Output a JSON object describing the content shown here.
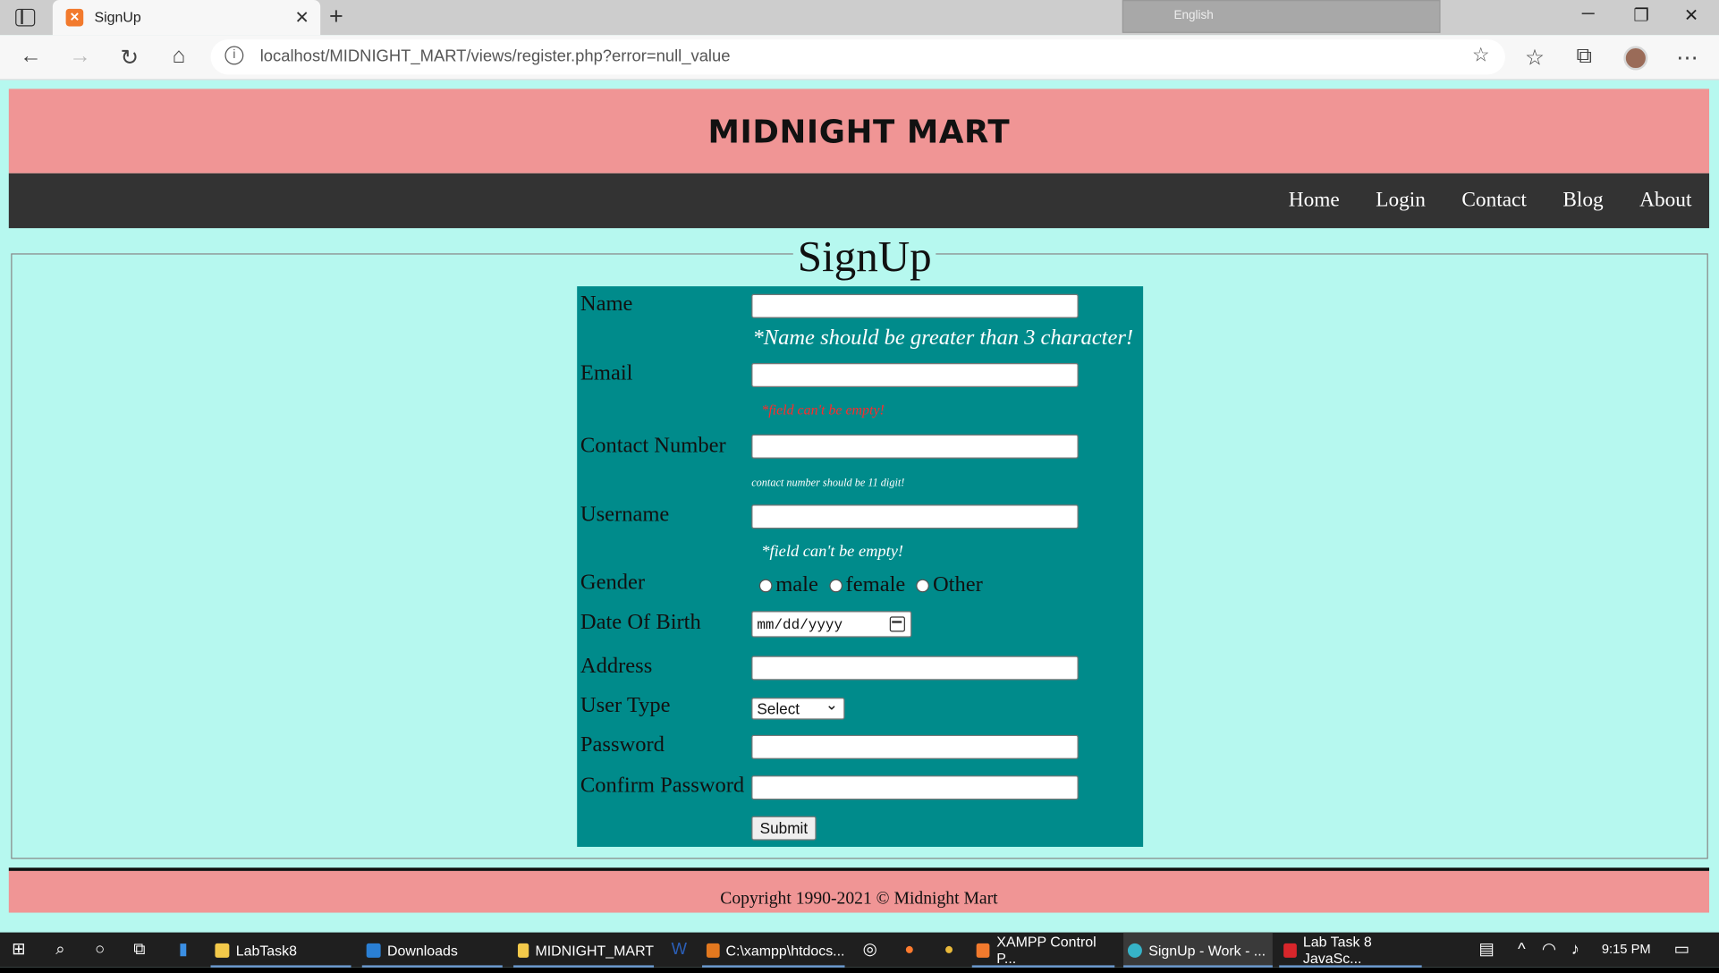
{
  "browser": {
    "tab_title": "SignUp",
    "url": "localhost/MIDNIGHT_MART/views/register.php?error=null_value",
    "lang": "English"
  },
  "site": {
    "title": "MIDNIGHT MART",
    "nav": [
      "Home",
      "Login",
      "Contact",
      "Blog",
      "About"
    ],
    "footer": "Copyright 1990-2021 © Midnight Mart"
  },
  "form": {
    "legend": "SignUp",
    "labels": {
      "name": "Name",
      "email": "Email",
      "contact": "Contact Number",
      "username": "Username",
      "gender": "Gender",
      "dob": "Date Of Birth",
      "address": "Address",
      "user_type": "User Type",
      "password": "Password",
      "confirm_password": "Confirm Password"
    },
    "messages": {
      "name": "*Name should be greater than 3 character!",
      "email": "*field can't be empty!",
      "contact": "contact number should be 11 digit!",
      "username": "*field can't be empty!"
    },
    "gender_options": [
      "male",
      "female",
      "Other"
    ],
    "dob_placeholder": "mm/dd/yyyy",
    "user_type_selected": "Select",
    "submit": "Submit"
  },
  "taskbar": {
    "apps": [
      "LabTask8",
      "Downloads",
      "MIDNIGHT_MART",
      "C:\\xampp\\htdocs...",
      "XAMPP Control P...",
      "SignUp - Work - ...",
      "Lab Task 8 JavaSc..."
    ],
    "time": "9:15 PM"
  },
  "colors": {
    "page_bg": "#b6f8ef",
    "header_bg": "#f09595",
    "nav_bg": "#333333",
    "form_bg": "#008b8b",
    "error_red": "#ff2a2a"
  }
}
